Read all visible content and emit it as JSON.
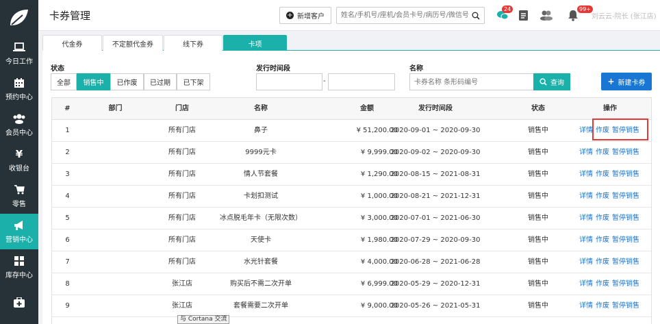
{
  "header": {
    "title": "卡券管理",
    "new_customer_label": "新增客户",
    "search_placeholder": "姓名/手机号/座机/会员卡号/病历号/微信号",
    "chat_badge": "24",
    "bell_badge": "99+",
    "user_name": "刘云云-院长 (张江店)"
  },
  "sidebar": {
    "items": [
      {
        "label": "今日工作",
        "icon": "laptop-icon"
      },
      {
        "label": "预约中心",
        "icon": "calendar-icon"
      },
      {
        "label": "会员中心",
        "icon": "users-icon"
      },
      {
        "label": "收银台",
        "icon": "yen-icon"
      },
      {
        "label": "零售",
        "icon": "cart-icon"
      },
      {
        "label": "营销中心",
        "icon": "megaphone-icon"
      },
      {
        "label": "库存中心",
        "icon": "grid-icon"
      },
      {
        "label": "",
        "icon": "medkit-icon"
      }
    ],
    "active_index": 5
  },
  "tabs": [
    "代金券",
    "不定额代金券",
    "线下券",
    "卡项"
  ],
  "active_tab": 3,
  "filters": {
    "status_label": "状态",
    "status_options": [
      "全部",
      "销售中",
      "已作废",
      "已过期",
      "已下架"
    ],
    "active_status": 1,
    "period_label": "发行时间段",
    "name_label": "名称",
    "name_placeholder": "卡券名称 条形码编号",
    "query_label": "查询",
    "new_card_label": "新建卡券"
  },
  "table": {
    "headers": [
      "#",
      "部门",
      "门店",
      "名称",
      "金额",
      "发行时间段",
      "状态",
      "操作"
    ],
    "rows": [
      {
        "no": "1",
        "dept": "",
        "store": "所有门店",
        "name": "鼻子",
        "amount": "¥ 51,200.00",
        "period": "2020-09-01 ~ 2020-09-30",
        "status": "销售中"
      },
      {
        "no": "2",
        "dept": "",
        "store": "所有门店",
        "name": "9999元卡",
        "amount": "¥ 9,999.00",
        "period": "2020-09-02 ~ 2020-09-30",
        "status": "销售中"
      },
      {
        "no": "3",
        "dept": "",
        "store": "所有门店",
        "name": "情人节套餐",
        "amount": "¥ 1,290.00",
        "period": "2020-08-15 ~ 2021-08-31",
        "status": "销售中"
      },
      {
        "no": "4",
        "dept": "",
        "store": "所有门店",
        "name": "卡划扣测试",
        "amount": "¥ 1,000.00",
        "period": "2020-08-21 ~ 2021-12-31",
        "status": "销售中"
      },
      {
        "no": "5",
        "dept": "",
        "store": "所有门店",
        "name": "冰点脱毛年卡（无限次数）",
        "amount": "¥ 3,000.00",
        "period": "2020-07-01 ~ 2021-06-30",
        "status": "销售中"
      },
      {
        "no": "6",
        "dept": "",
        "store": "所有门店",
        "name": "天使卡",
        "amount": "¥ 1,980.00",
        "period": "2020-07-29 ~ 2020-09-30",
        "status": "销售中"
      },
      {
        "no": "7",
        "dept": "",
        "store": "所有门店",
        "name": "水光针套餐",
        "amount": "¥ 4,000.00",
        "period": "2020-06-28 ~ 2021-06-28",
        "status": "销售中"
      },
      {
        "no": "8",
        "dept": "",
        "store": "张江店",
        "name": "购买后不需二次开单",
        "amount": "¥ 6,999.00",
        "period": "2020-05-29 ~ 2020-12-31",
        "status": "销售中"
      },
      {
        "no": "9",
        "dept": "",
        "store": "张江店",
        "name": "套餐需要二次开单",
        "amount": "¥ 9,000.00",
        "period": "2020-05-26 ~ 2021-05-31",
        "status": "销售中"
      }
    ],
    "actions": [
      "详情",
      "作废",
      "暂停销售"
    ]
  },
  "tooltip": "与 Cortana 交流",
  "colors": {
    "sidebar": "#263238",
    "accent": "#1bb0a9",
    "primary": "#1976d2",
    "link": "#1976d2",
    "highlight": "#e53935"
  }
}
